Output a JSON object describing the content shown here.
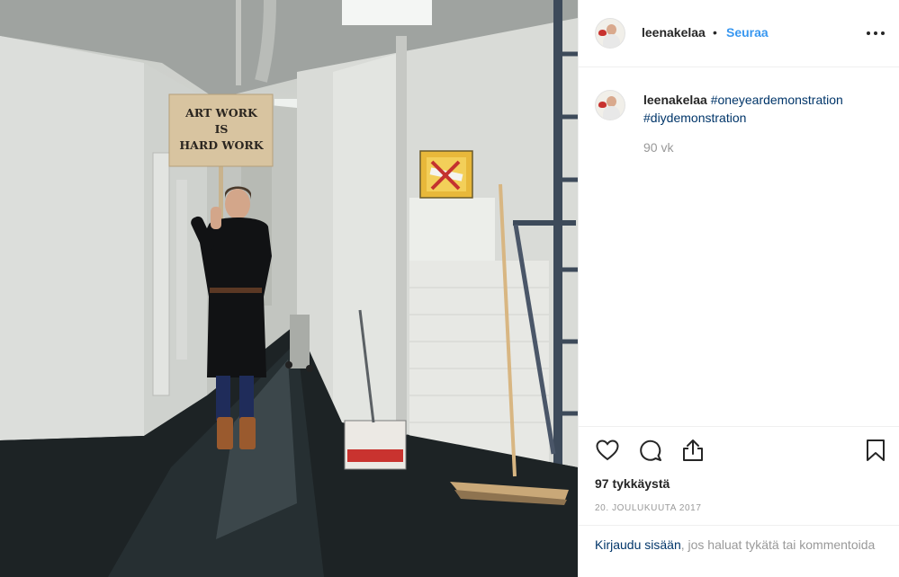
{
  "post": {
    "username": "leenakelaa",
    "separator": "•",
    "follow_label": "Seuraa",
    "more_icon": "more-horizontal-icon",
    "sign_lines": [
      "ART WORK",
      "IS",
      "HARD WORK"
    ]
  },
  "caption": {
    "username": "leenakelaa",
    "hashtags": [
      "#oneyeardemonstration",
      "#diydemonstration"
    ],
    "time": "90 vk"
  },
  "actions": {
    "icons": [
      "heart-icon",
      "comment-icon",
      "share-icon",
      "bookmark-icon"
    ],
    "likes": "97 tykkäystä",
    "date": "20. joulukuuta 2017"
  },
  "login": {
    "link": "Kirjaudu sisään",
    "rest": ", jos haluat tykätä tai kommentoida"
  },
  "colors": {
    "link_blue": "#3897f0",
    "hashtag_blue": "#003569",
    "muted": "#999999",
    "text": "#262626"
  }
}
